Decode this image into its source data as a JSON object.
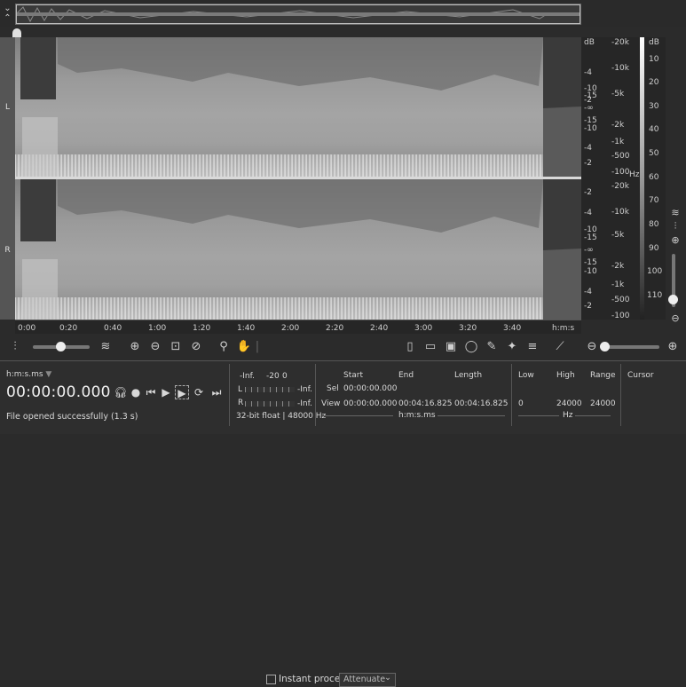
{
  "overview": {
    "collapse_icon": "chevron-down-icon",
    "expand_icon": "chevron-up-icon"
  },
  "channels": {
    "left_label": "L",
    "right_label": "R"
  },
  "db_axis": {
    "unit": "dB",
    "left_channel": [
      "-2",
      "-4",
      "-10",
      "-15",
      "-∞",
      "-15",
      "-10",
      "-4",
      "-2"
    ],
    "right_channel": [
      "-2",
      "-4",
      "-10",
      "-15",
      "-∞",
      "-15",
      "-10",
      "-4",
      "-2"
    ]
  },
  "hz_axis": {
    "unit": "Hz",
    "left_channel": [
      "-20k",
      "-10k",
      "-5k",
      "-2k",
      "-1k",
      "-500",
      "-100"
    ],
    "right_channel": [
      "-20k",
      "-10k",
      "-5k",
      "-2k",
      "-1k",
      "-500",
      "-100"
    ]
  },
  "color_scale": {
    "unit": "dB",
    "ticks": [
      "10",
      "20",
      "30",
      "40",
      "50",
      "60",
      "70",
      "80",
      "90",
      "100",
      "110"
    ]
  },
  "time_axis": {
    "labels": [
      "0:00",
      "0:20",
      "0:40",
      "1:00",
      "1:20",
      "1:40",
      "2:00",
      "2:20",
      "2:40",
      "3:00",
      "3:20",
      "3:40"
    ],
    "unit": "h:m:s"
  },
  "toolbar": {
    "instant_process_label": "Instant process",
    "mode_select": "Attenuate",
    "mode_arrow": "⌄"
  },
  "time_panel": {
    "format_label": "h:m:s.ms",
    "format_arrow": "▼",
    "current_time": "00:00:00.000",
    "status": "File opened successfully (1.3 s)"
  },
  "meter": {
    "scale": [
      "-Inf.",
      "-20",
      "0"
    ],
    "left_label": "L",
    "right_label": "R",
    "left_peak": "-Inf.",
    "right_peak": "-Inf.",
    "format": "32-bit float | 48000 Hz"
  },
  "selection": {
    "headers": {
      "start": "Start",
      "end": "End",
      "length": "Length"
    },
    "sel_label": "Sel",
    "sel_start": "00:00:00.000",
    "view_label": "View",
    "view_start": "00:00:00.000",
    "view_end": "00:04:16.825",
    "view_length": "00:04:16.825",
    "unit": "h:m:s.ms"
  },
  "frequency": {
    "headers": {
      "low": "Low",
      "high": "High",
      "range": "Range"
    },
    "low": "0",
    "high": "24000",
    "range": "24000",
    "unit": "Hz"
  },
  "cursor": {
    "header": "Cursor"
  }
}
